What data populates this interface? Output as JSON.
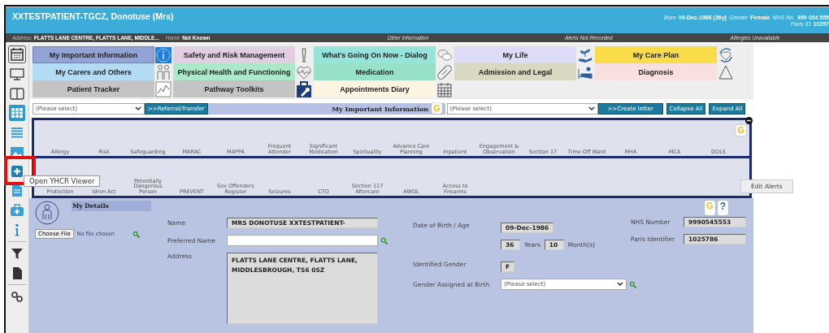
{
  "header": {
    "patient_name": "XXTESTPATIENT-TGCZ, Donotuse (Mrs)",
    "facts": [
      {
        "label": "Born",
        "value": "09-Dec-1986 (36y)"
      },
      {
        "label": "Gender",
        "value": "Female"
      },
      {
        "label": "NHS No.",
        "value": "999 054 555"
      }
    ],
    "paris": {
      "label": "Paris ID",
      "value": "10257"
    }
  },
  "info_bar": {
    "address": {
      "label": "Address",
      "value": "FLATTS LANE CENTRE, FLATTS LANE, MIDDLE..."
    },
    "home": {
      "label": "Home",
      "value": "Not Known"
    },
    "other": "Other Information",
    "alerts": "Alerts Not Recorded",
    "allergies": "Allergies Unavailable"
  },
  "sidebar": {
    "items": [
      {
        "selected": true
      },
      {
        "selected": false
      },
      {
        "selected": false
      },
      {
        "selected": true
      },
      {
        "selected": false
      },
      {
        "selected": false
      },
      {
        "selected": false
      },
      {
        "selected": false
      },
      {
        "selected": false
      },
      {
        "selected": false
      },
      {
        "selected": false
      },
      {
        "selected": false
      },
      {
        "selected": false
      }
    ]
  },
  "menu": {
    "rows": [
      [
        {
          "label": "My Important Information",
          "color": "#93a3d6",
          "selected": true
        },
        {
          "label": "Safety and Risk Management",
          "color": "#e3cde3",
          "selected": false
        },
        {
          "label": "What's Going On Now - Dialog",
          "color": "#95e3da",
          "selected": false
        },
        {
          "label": "My Life",
          "color": "#dcdcf8",
          "selected": false
        },
        {
          "label": "My Care Plan",
          "color": "#f8dc4a",
          "selected": false
        }
      ],
      [
        {
          "label": "My Carers and Others",
          "color": "#b3dcf4",
          "selected": false
        },
        {
          "label": "Physical Health and Functioning",
          "color": "#ade8c8",
          "selected": false
        },
        {
          "label": "Medication",
          "color": "#97e2c6",
          "selected": false
        },
        {
          "label": "Admission and Legal",
          "color": "#d9d8c2",
          "selected": false
        },
        {
          "label": "Diagnosis",
          "color": "#f8e0e0",
          "selected": false
        }
      ],
      [
        {
          "label": "Patient Tracker",
          "color": "#c4c4c4",
          "selected": false
        },
        {
          "label": "Pathway Toolkits",
          "color": "#c4c4c4",
          "selected": false
        },
        {
          "label": "Appointments Diary",
          "color": "#fdf4e2",
          "selected": false
        }
      ]
    ]
  },
  "toolbar": {
    "left_select": "(Please select)",
    "referral_button": ">>Referral/Transfer",
    "section_title": "My Important Information",
    "section_badge": "G",
    "right_select": "(Please select)",
    "create_letter_button": ">>Create letter",
    "collapse_button": "Collapse All",
    "expand_button": "Expand All"
  },
  "alert_panels": [
    {
      "labels": [
        "Allergy",
        "Risk",
        "Safeguarding",
        "MARAC",
        "MAPPA",
        "Frequent Attender",
        "Significant Medication",
        "Spirituality",
        "Advance Care Planning",
        "Inpatient",
        "Engagement & Observation",
        "Section 17",
        "Time Off Ward",
        "MHA",
        "MCA",
        "DOLS"
      ],
      "badge": "G"
    },
    {
      "labels": [
        "Protection",
        "ldren Act",
        "Potentially Dangerous Person",
        "PREVENT",
        "Sex Offenders Register",
        "Seizures",
        "CTO",
        "Section 117 Aftercare",
        "AWOL",
        "Access to Firearms"
      ],
      "edit_button": "Edit Alerts"
    }
  ],
  "tooltip": "Open YHCR Viewer",
  "details": {
    "title": "My Details",
    "choose_file_button": "Choose File",
    "file_status": "No file chosen",
    "badges": [
      "G",
      "?"
    ],
    "name": {
      "label": "Name",
      "value": "MRS DONOTUSE XXTESTPATIENT-"
    },
    "preferred_name": {
      "label": "Preferred Name"
    },
    "address": {
      "label": "Address",
      "value": "FLATTS LANE CENTRE, FLATTS LANE, MIDDLESBROUGH, TS6 0SZ"
    },
    "dob": {
      "label": "Date of Birth / Age",
      "value": "09-Dec-1986"
    },
    "age": {
      "years": "36",
      "years_label": "Years",
      "months": "10",
      "months_label": "Month(s)"
    },
    "identified_gender": {
      "label": "Identified Gender",
      "value": "F"
    },
    "gender_at_birth": {
      "label": "Gender Assigned at Birth",
      "value": "(Please select)"
    },
    "nhs_number": {
      "label": "NHS Number",
      "value": "9990545553"
    },
    "paris_identifier": {
      "label": "Paris Identifier",
      "value": "1025786"
    }
  }
}
